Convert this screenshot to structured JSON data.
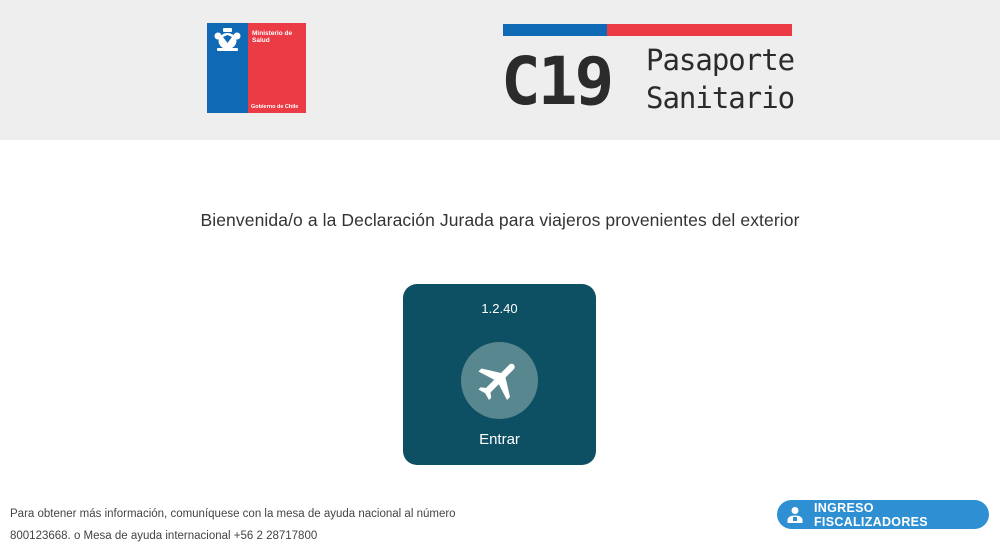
{
  "header": {
    "logo": {
      "ministry": "Ministerio de Salud",
      "government": "Gobierno de Chile",
      "colors": {
        "blue": "#0f69b4",
        "red": "#eb3c46"
      },
      "seal_icon": "chile-coat-of-arms-icon"
    },
    "brand": {
      "code": "C19",
      "line1": "Pasaporte",
      "line2": "Sanitario"
    },
    "background": "#eeeeee"
  },
  "main": {
    "welcome": "Bienvenida/o a la Declaración Jurada para viajeros provenientes del exterior",
    "card": {
      "version": "1.2.40",
      "label": "Entrar",
      "icon": "airplane-icon",
      "background": "#0d4f63",
      "circle": "#59878f"
    }
  },
  "footer": {
    "info_line1": "Para obtener más información, comuníquese con la mesa de ayuda nacional al número",
    "info_line2": "800123668. o Mesa de ayuda internacional +56 2 28717800",
    "fiscal_button": {
      "label": "INGRESO FISCALIZADORES",
      "icon": "user-badge-icon",
      "color": "#2f8fd3"
    }
  }
}
